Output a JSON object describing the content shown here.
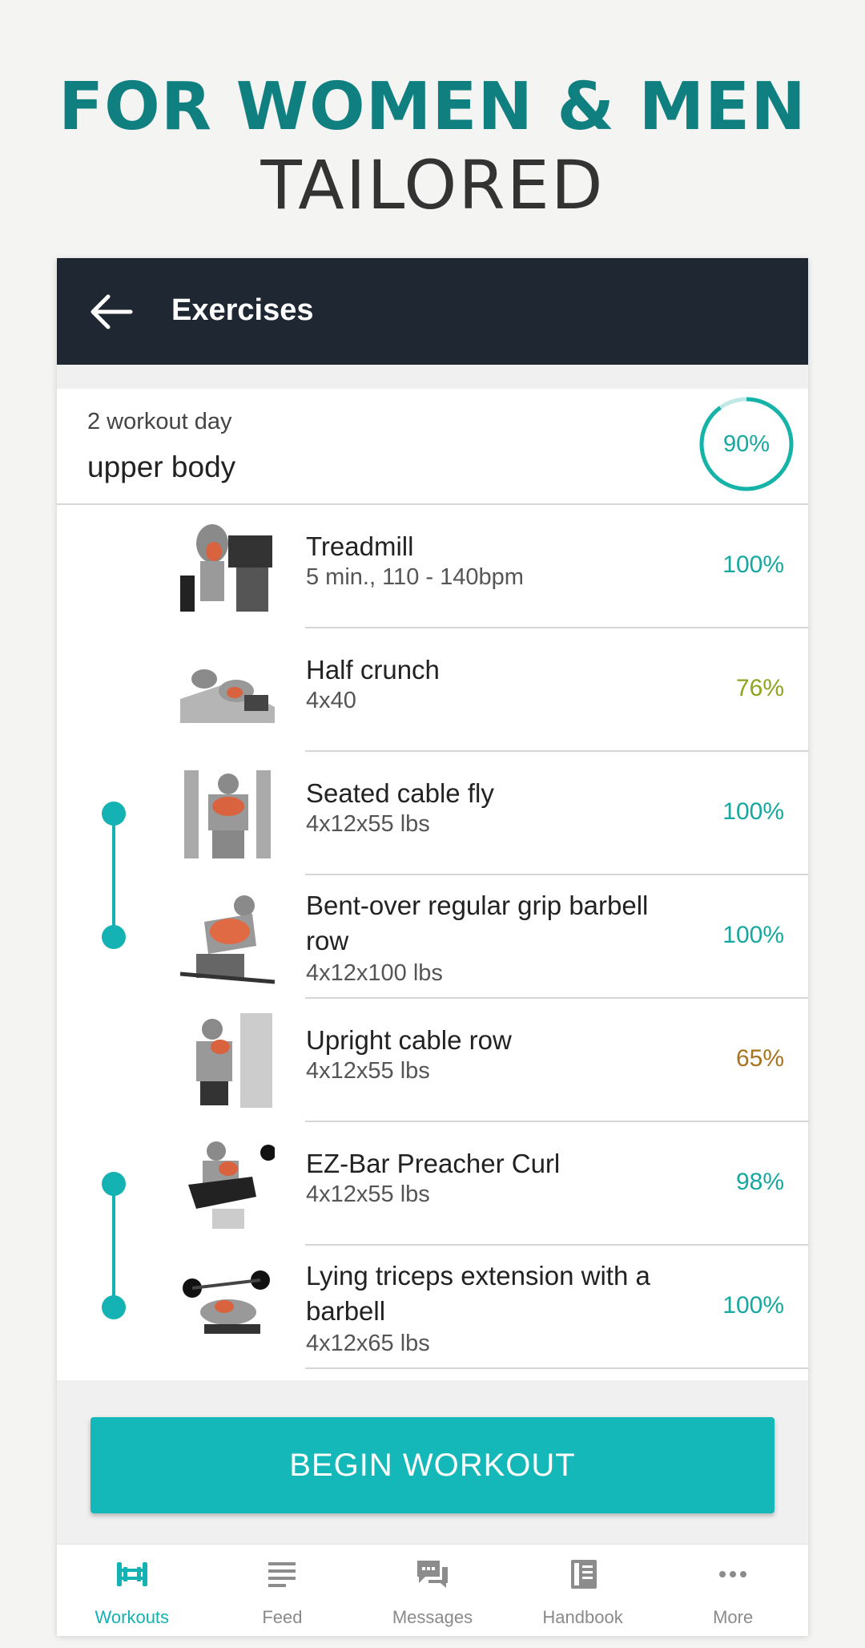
{
  "promo": {
    "line1": "FOR WOMEN & MEN",
    "line2": "TAILORED"
  },
  "appbar": {
    "title": "Exercises",
    "back_icon": "arrow-left-icon"
  },
  "day": {
    "subtitle": "2 workout day",
    "title": "upper body",
    "progress_label": "90%",
    "progress": 0.9
  },
  "colors": {
    "teal": "#14b2b2",
    "appbar": "#1f2732",
    "green": "#16a89f",
    "olive": "#8ea41d",
    "amber": "#a8731d"
  },
  "exercises": [
    {
      "name": "Treadmill",
      "detail": "5 min., 110 - 140bpm",
      "percent": "100%",
      "color": "#16a89f"
    },
    {
      "name": "Half crunch",
      "detail": "4x40",
      "percent": "76%",
      "color": "#8ea41d"
    },
    {
      "name": "Seated cable fly",
      "detail": "4x12x55 lbs",
      "percent": "100%",
      "color": "#16a89f"
    },
    {
      "name": "Bent-over regular grip barbell row",
      "detail": "4x12x100 lbs",
      "percent": "100%",
      "color": "#16a89f"
    },
    {
      "name": "Upright cable row",
      "detail": "4x12x55 lbs",
      "percent": "65%",
      "color": "#a8731d"
    },
    {
      "name": "EZ-Bar Preacher Curl",
      "detail": "4x12x55 lbs",
      "percent": "98%",
      "color": "#16a89f"
    },
    {
      "name": "Lying triceps extension with a barbell",
      "detail": "4x12x65 lbs",
      "percent": "100%",
      "color": "#16a89f"
    }
  ],
  "begin_button": "BEGIN WORKOUT",
  "nav": [
    {
      "label": "Workouts",
      "icon": "dumbbell-icon",
      "active": true
    },
    {
      "label": "Feed",
      "icon": "feed-lines-icon",
      "active": false
    },
    {
      "label": "Messages",
      "icon": "chat-bubbles-icon",
      "active": false
    },
    {
      "label": "Handbook",
      "icon": "book-icon",
      "active": false
    },
    {
      "label": "More",
      "icon": "more-dots-icon",
      "active": false
    }
  ]
}
